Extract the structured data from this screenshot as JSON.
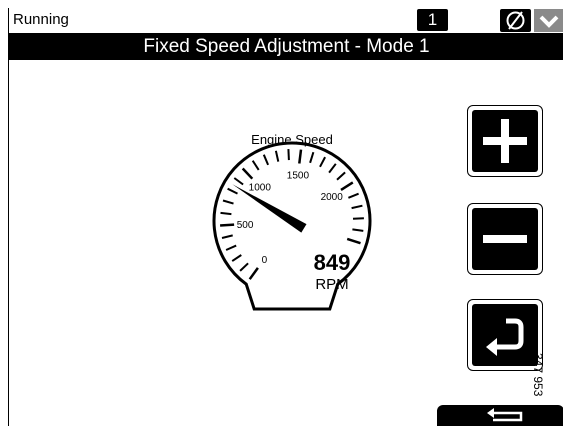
{
  "status_bar": {
    "status_text": "Running",
    "page_number": "1",
    "no_sync_icon": "circle-slash-icon",
    "dropdown_icon": "chevron-down-icon"
  },
  "title": "Fixed Speed Adjustment - Mode 1",
  "gauge": {
    "label": "Engine Speed",
    "value": "849",
    "unit": "RPM",
    "min": 0,
    "max": 2500,
    "current_rpm": 849,
    "tick_labels": [
      "0",
      "500",
      "1000",
      "1500",
      "2000"
    ]
  },
  "buttons": {
    "increase_icon": "plus-icon",
    "decrease_icon": "minus-icon",
    "enter_icon": "enter-return-icon",
    "back_icon": "back-arrow-icon"
  },
  "figure_id": "347 953",
  "colors": {
    "background": "#ffffff",
    "bars": "#000000",
    "disabled": "#8a8a8a"
  }
}
